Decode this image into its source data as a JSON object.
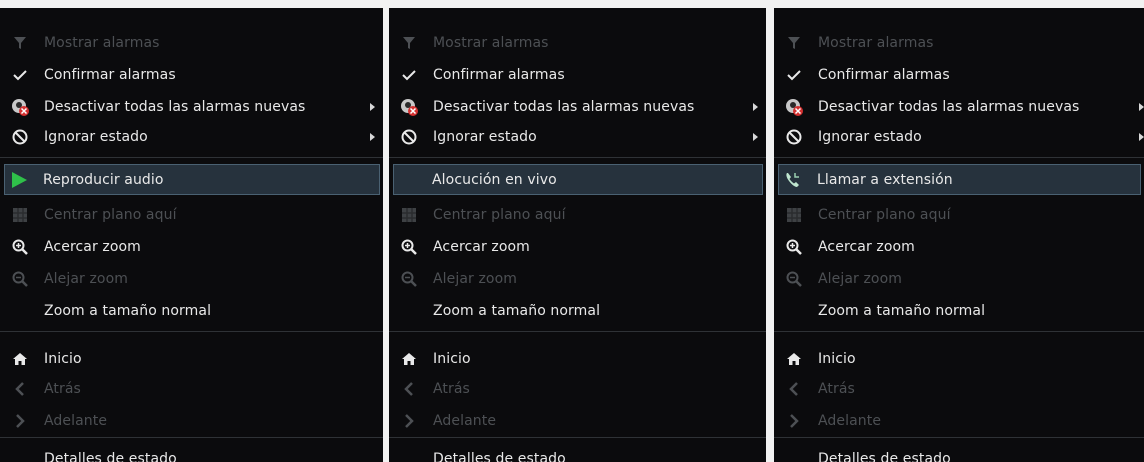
{
  "menu": {
    "show_alarms": "Mostrar alarmas",
    "confirm_alarms": "Confirmar alarmas",
    "disable_new_alarms": "Desactivar todas las alarmas nuevas",
    "ignore_state": "Ignorar estado",
    "center_map": "Centrar plano aquí",
    "zoom_in": "Acercar zoom",
    "zoom_out": "Alejar zoom",
    "zoom_normal": "Zoom a tamaño normal",
    "home": "Inicio",
    "back": "Atrás",
    "forward": "Adelante",
    "state_details": "Detalles de estado"
  },
  "panels": [
    {
      "selected_label": "Reproducir audio",
      "selected_icon": "play-icon"
    },
    {
      "selected_label": "Alocución en vivo",
      "selected_icon": ""
    },
    {
      "selected_label": "Llamar a extensión",
      "selected_icon": "phone-icon"
    }
  ],
  "colors": {
    "background": "#0b0b0d",
    "text": "#e9e9e9",
    "disabled_text": "#4d5054",
    "highlight_bg": "#26323d",
    "highlight_border": "#4a6172",
    "play_green": "#2fc04a"
  }
}
